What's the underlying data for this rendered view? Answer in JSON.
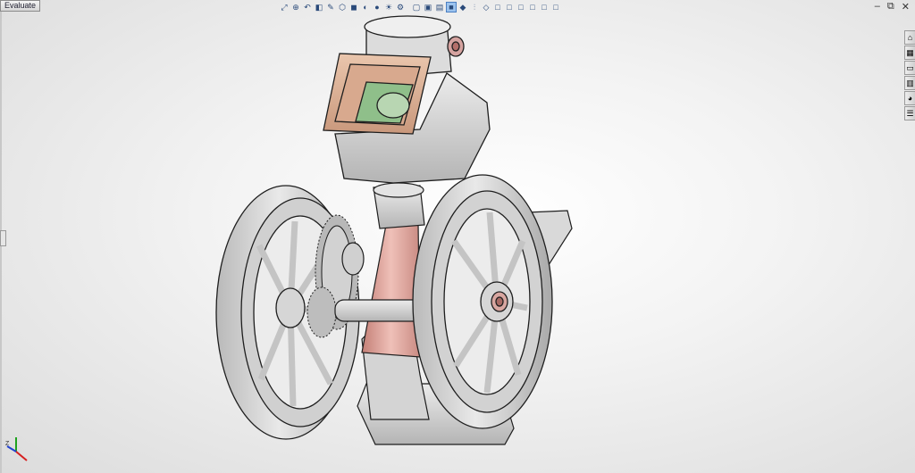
{
  "command_manager": {
    "active_tab": "Evaluate"
  },
  "heads_up_toolbar": {
    "tools": [
      {
        "icon": "zoom-to-fit-icon",
        "glyph": "⤢"
      },
      {
        "icon": "zoom-area-icon",
        "glyph": "⊕"
      },
      {
        "icon": "previous-view-icon",
        "glyph": "↶"
      },
      {
        "icon": "section-view-icon",
        "glyph": "◧"
      },
      {
        "icon": "dynamic-annotation-icon",
        "glyph": "✎"
      },
      {
        "icon": "view-orientation-icon",
        "glyph": "⬡"
      },
      {
        "icon": "display-style-icon",
        "glyph": "◼"
      },
      {
        "icon": "hide-show-icon",
        "glyph": "◐"
      },
      {
        "icon": "edit-appearance-icon",
        "glyph": "●"
      },
      {
        "icon": "apply-scene-icon",
        "glyph": "☀"
      },
      {
        "icon": "view-settings-icon",
        "glyph": "⚙"
      }
    ],
    "views": [
      {
        "icon": "wireframe-icon",
        "glyph": "▢"
      },
      {
        "icon": "hidden-lines-visible-icon",
        "glyph": "▣"
      },
      {
        "icon": "hidden-lines-removed-icon",
        "glyph": "▤"
      },
      {
        "icon": "shaded-with-edges-icon",
        "glyph": "■",
        "active": true
      },
      {
        "icon": "shaded-icon",
        "glyph": "◆"
      },
      {
        "icon": "section-icon",
        "glyph": "⫶"
      },
      {
        "icon": "isometric-icon",
        "glyph": "◇"
      },
      {
        "icon": "front-view-icon",
        "glyph": "□"
      },
      {
        "icon": "top-view-icon",
        "glyph": "□"
      },
      {
        "icon": "right-view-icon",
        "glyph": "□"
      },
      {
        "icon": "left-view-icon",
        "glyph": "□"
      },
      {
        "icon": "back-view-icon",
        "glyph": "□"
      },
      {
        "icon": "bottom-view-icon",
        "glyph": "□"
      }
    ]
  },
  "window_controls": {
    "minimize": "–",
    "restore": "⧉",
    "close": "✕"
  },
  "task_pane": {
    "tabs": [
      {
        "icon": "resources-icon",
        "glyph": "⌂"
      },
      {
        "icon": "design-library-icon",
        "glyph": "▦"
      },
      {
        "icon": "file-explorer-icon",
        "glyph": "▭"
      },
      {
        "icon": "view-palette-icon",
        "glyph": "▥"
      },
      {
        "icon": "appearances-icon",
        "glyph": "◕"
      },
      {
        "icon": "custom-properties-icon",
        "glyph": "☰"
      }
    ]
  },
  "triad": {
    "x_label": "X",
    "y_label": "Y",
    "z_label": "Z"
  },
  "colors": {
    "part_gray": "#cfcfcf",
    "edge": "#1e1e1e",
    "hopper_tan": "#e0b89c",
    "hopper_green": "#8fbf8a",
    "cylinder_pink": "#e2a39a",
    "axis_x": "#d62020",
    "axis_y": "#1fa21f",
    "axis_z": "#2040d0"
  }
}
